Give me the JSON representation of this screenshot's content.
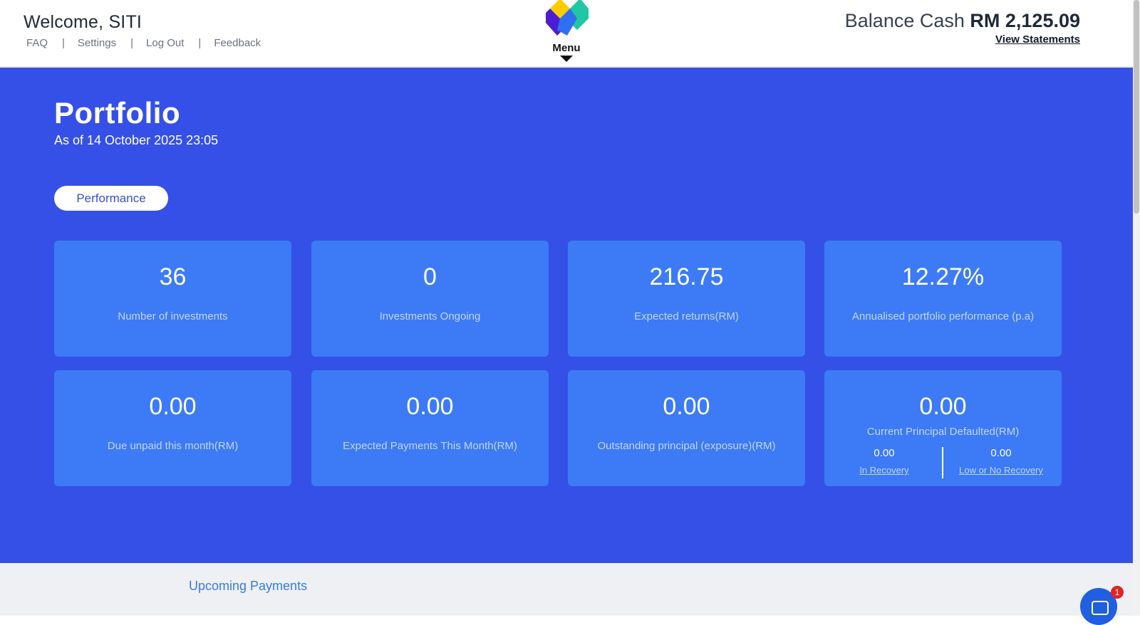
{
  "header": {
    "welcome_prefix": "Welcome,",
    "user_name": "SITI",
    "nav": [
      "FAQ",
      "Settings",
      "Log Out",
      "Feedback"
    ],
    "nav_separator": "|",
    "menu_label": "Menu",
    "balance_label": "Balance Cash",
    "balance_amount": "RM 2,125.09",
    "statements_label": "View Statements"
  },
  "portfolio": {
    "title": "Portfolio",
    "as_of": "As of 14 October 2025 23:05",
    "tab_label": "Performance"
  },
  "cards": [
    {
      "value": "36",
      "label": "Number of investments"
    },
    {
      "value": "0",
      "label": "Investments Ongoing"
    },
    {
      "value": "216.75",
      "label": "Expected returns(RM)"
    },
    {
      "value": "12.27%",
      "label": "Annualised portfolio performance (p.a)"
    },
    {
      "value": "0.00",
      "label": "Due unpaid this month(RM)"
    },
    {
      "value": "0.00",
      "label": "Expected Payments This Month(RM)"
    },
    {
      "value": "0.00",
      "label": "Outstanding principal (exposure)(RM)"
    },
    {
      "value": "0.00",
      "label": "Current Principal Defaulted(RM)",
      "breakdown": [
        {
          "value": "0.00",
          "label": "In Recovery"
        },
        {
          "value": "0.00",
          "label": "Low or No Recovery"
        }
      ]
    }
  ],
  "lower": {
    "upcoming_label": "Upcoming Payments"
  },
  "chat": {
    "badge_count": "1"
  },
  "colors": {
    "hero_bg": "#3550e6",
    "card_bg": "#3c7bf5",
    "card_label": "#c3d4fb",
    "link_blue": "#3a7be0",
    "badge_red": "#e02424"
  }
}
